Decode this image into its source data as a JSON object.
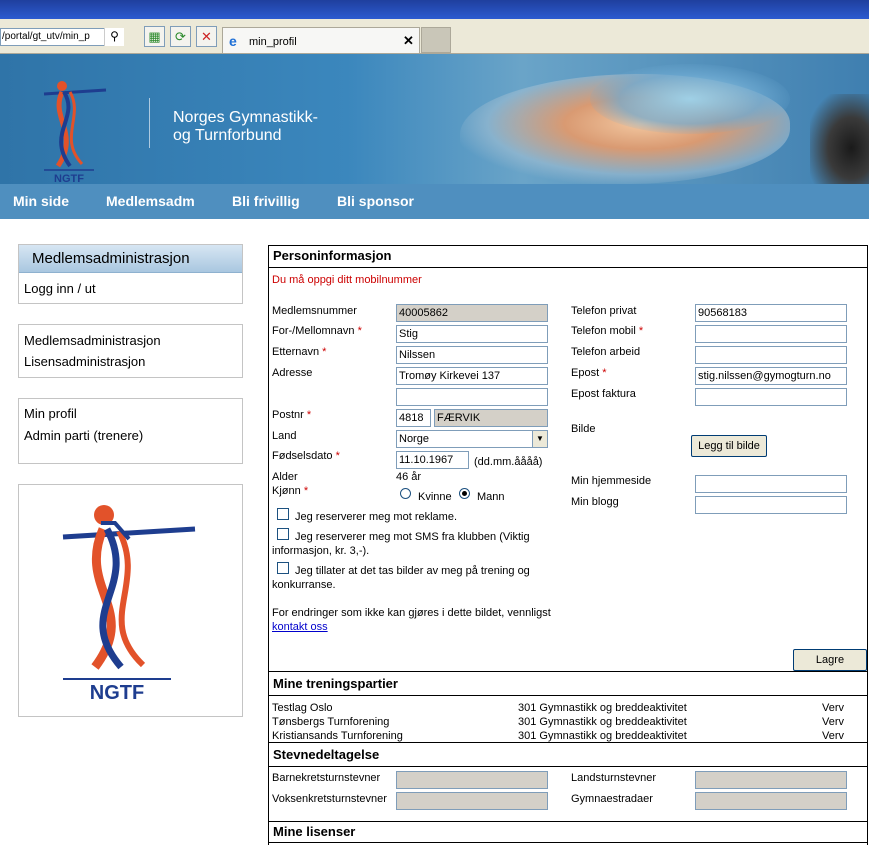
{
  "browser": {
    "address": "/portal/gt_utv/min_p",
    "tab_title": "min_profil"
  },
  "banner": {
    "org_name_line1": "Norges Gymnastikk-",
    "org_name_line2": "og Turnforbund",
    "logo_text": "NGTF"
  },
  "nav": {
    "items": [
      "Min side",
      "Medlemsadm",
      "Bli frivillig",
      "Bli sponsor"
    ]
  },
  "sidebar": {
    "box1_title": "Medlemsadministrasjon",
    "box1_link": "Logg inn / ut",
    "box2_links": [
      "Medlemsadministrasjon",
      "Lisensadministrasjon"
    ],
    "box3_links": [
      "Min profil",
      "Admin parti (trenere)"
    ],
    "logo_text": "NGTF"
  },
  "person": {
    "title": "Personinformasjon",
    "warning": "Du må oppgi ditt mobilnummer",
    "labels": {
      "medlemsnummer": "Medlemsnummer",
      "fornavn": "For-/Mellomnavn",
      "etternavn": "Etternavn",
      "adresse": "Adresse",
      "postnr": "Postnr",
      "land": "Land",
      "fodselsdato": "Fødselsdato",
      "alder": "Alder",
      "kjonn": "Kjønn",
      "tlf_privat": "Telefon privat",
      "tlf_mobil": "Telefon mobil",
      "tlf_arbeid": "Telefon arbeid",
      "epost": "Epost",
      "epost_faktura": "Epost faktura",
      "bilde": "Bilde",
      "hjemmeside": "Min hjemmeside",
      "blogg": "Min blogg"
    },
    "required_mark": "*",
    "values": {
      "medlemsnummer": "40005862",
      "fornavn": "Stig",
      "etternavn": "Nilssen",
      "adresse1": "Tromøy Kirkevei 137",
      "adresse2": "",
      "postnr": "4818",
      "poststed": "FÆRVIK",
      "land": "Norge",
      "fodselsdato": "11.10.1967",
      "date_format": "(dd.mm.åååå)",
      "alder": "46 år",
      "tlf_privat": "90568183",
      "tlf_mobil": "",
      "tlf_arbeid": "",
      "epost": "stig.nilssen@gymogturn.no",
      "epost_faktura": "",
      "hjemmeside": "",
      "blogg": ""
    },
    "gender_options": [
      "Kvinne",
      "Mann"
    ],
    "gender_selected": "Mann",
    "checkbox1": "Jeg reserverer meg mot reklame.",
    "checkbox2_line1": "Jeg reserverer meg mot SMS fra klubben (Viktig",
    "checkbox2_line2": "informasjon, kr. 3,-).",
    "checkbox3_line1": "Jeg tillater at det tas bilder av meg på trening og",
    "checkbox3_line2": "konkurranse.",
    "info_text": "For endringer som ikke kan gjøres i dette bildet, vennligst",
    "contact_link": "kontakt oss",
    "add_image_button": "Legg til bilde",
    "save_button": "Lagre"
  },
  "training": {
    "title": "Mine treningspartier",
    "rows": [
      {
        "club": "Testlag Oslo",
        "group": "301 Gymnastikk og breddeaktivitet",
        "action": "Verv"
      },
      {
        "club": "Tønsbergs Turnforening",
        "group": "301 Gymnastikk og breddeaktivitet",
        "action": "Verv"
      },
      {
        "club": "Kristiansands Turnforening",
        "group": "301 Gymnastikk og breddeaktivitet",
        "action": "Verv"
      }
    ]
  },
  "events": {
    "title": "Stevnedeltagelse",
    "labels": [
      "Barnekretsturnstevner",
      "Voksenkretsturnstevner",
      "Landsturnstevner",
      "Gymnaestradaer"
    ]
  },
  "next_section_title": "Mine lisenser"
}
